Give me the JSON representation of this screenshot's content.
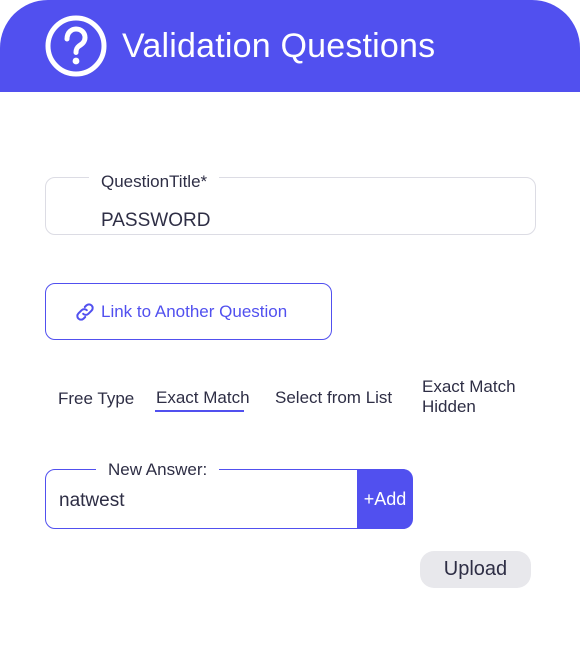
{
  "header": {
    "title": "Validation Questions",
    "icon": "help-circle-icon",
    "color": "#5150ef"
  },
  "question_title": {
    "label": "QuestionTitle*",
    "value": "PASSWORD"
  },
  "link_button": {
    "label": "Link to Another Question",
    "icon": "link-icon"
  },
  "tabs": [
    {
      "label": "Free Type",
      "active": false
    },
    {
      "label": "Exact Match",
      "active": true
    },
    {
      "label": "Select from List",
      "active": false
    },
    {
      "label_line1": "Exact Match",
      "label_line2": "Hidden",
      "active": false
    }
  ],
  "new_answer": {
    "label": "New Answer:",
    "value": "natwest",
    "add_label": "+Add"
  },
  "upload": {
    "label": "Upload"
  },
  "colors": {
    "accent": "#5150ef",
    "text": "#2e2e45",
    "button_gray": "#e8e8ec"
  }
}
